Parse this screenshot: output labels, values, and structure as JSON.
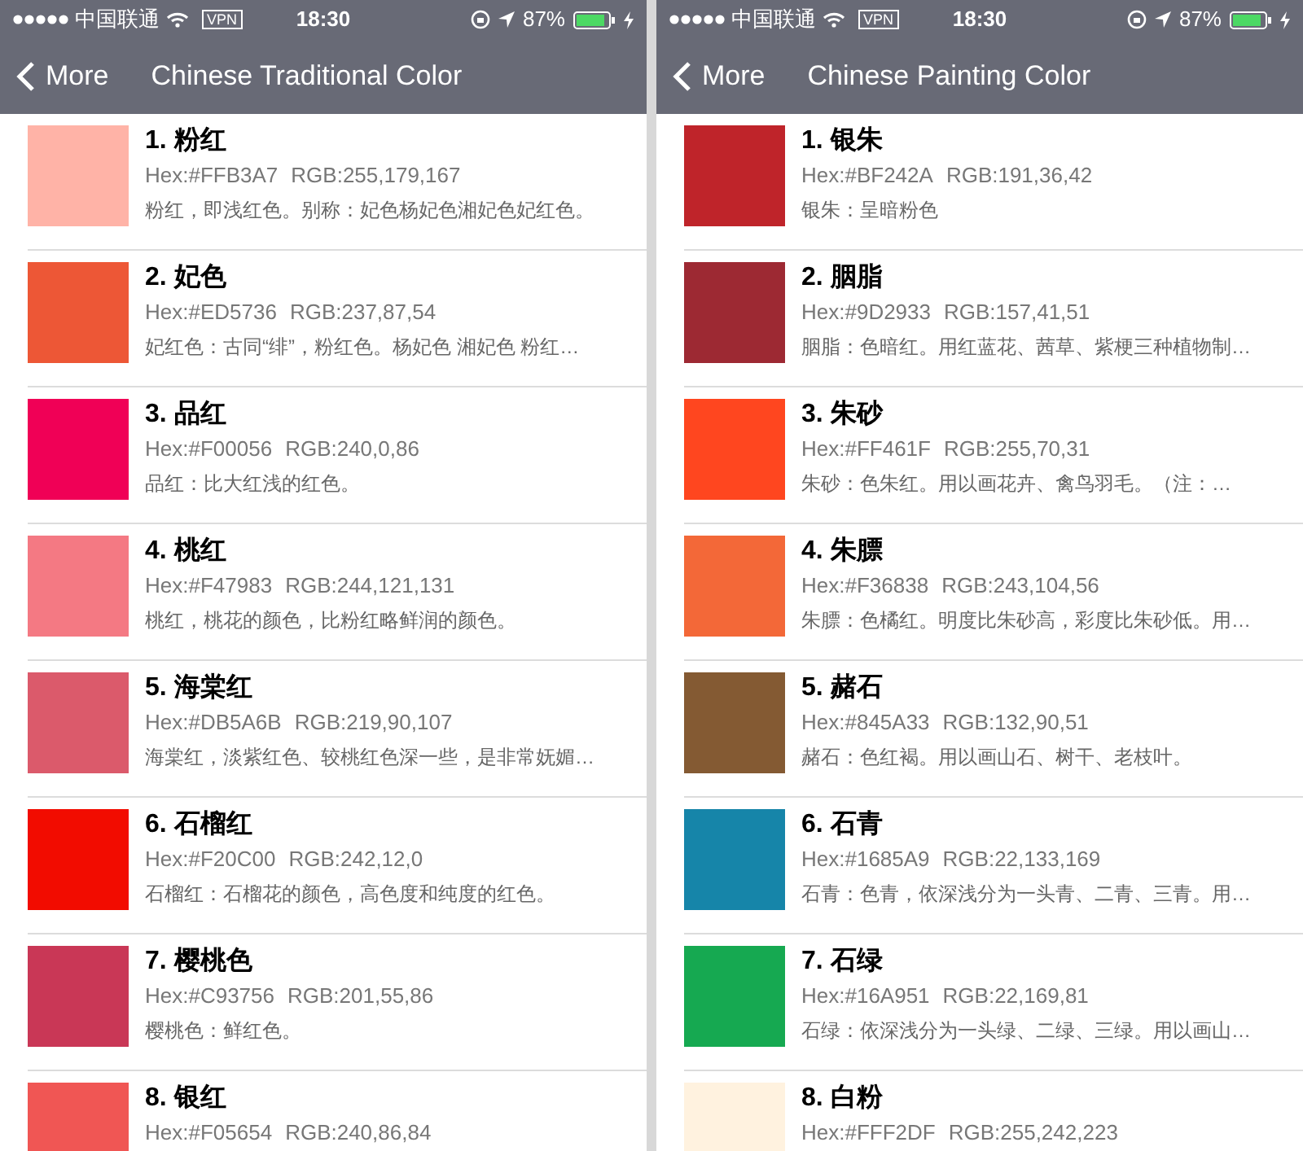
{
  "panels": [
    {
      "status_bar": {
        "carrier": "中国联通",
        "vpn": "VPN",
        "time": "18:30",
        "battery": "87%"
      },
      "nav": {
        "back": "More",
        "title": "Chinese Traditional Color"
      },
      "colors": [
        {
          "name": "1. 粉红",
          "hex": "Hex:#FFB3A7",
          "rgb": "RGB:255,179,167",
          "description": "粉红，即浅红色。别称：妃色杨妃色湘妃色妃红色。",
          "color": "#ffb3a7"
        },
        {
          "name": "2. 妃色",
          "hex": "Hex:#ED5736",
          "rgb": "RGB:237,87,54",
          "description": "妃红色：古同“绯”，粉红色。杨妃色 湘妃色 粉红…",
          "color": "#ed5736"
        },
        {
          "name": "3. 品红",
          "hex": "Hex:#F00056",
          "rgb": "RGB:240,0,86",
          "description": "品红：比大红浅的红色。",
          "color": "#f00056"
        },
        {
          "name": "4. 桃红",
          "hex": "Hex:#F47983",
          "rgb": "RGB:244,121,131",
          "description": "桃红，桃花的颜色，比粉红略鲜润的颜色。",
          "color": "#f47983"
        },
        {
          "name": "5. 海棠红",
          "hex": "Hex:#DB5A6B",
          "rgb": "RGB:219,90,107",
          "description": "海棠红，淡紫红色、较桃红色深一些，是非常妩媚…",
          "color": "#db5a6b"
        },
        {
          "name": "6. 石榴红",
          "hex": "Hex:#F20C00",
          "rgb": "RGB:242,12,0",
          "description": "石榴红：石榴花的颜色，高色度和纯度的红色。",
          "color": "#f20c00"
        },
        {
          "name": "7. 樱桃色",
          "hex": "Hex:#C93756",
          "rgb": "RGB:201,55,86",
          "description": "樱桃色：鲜红色。",
          "color": "#c93756"
        },
        {
          "name": "8. 银红",
          "hex": "Hex:#F05654",
          "rgb": "RGB:240,86,84",
          "color": "#f05654"
        }
      ]
    },
    {
      "status_bar": {
        "carrier": "中国联通",
        "vpn": "VPN",
        "time": "18:30",
        "battery": "87%"
      },
      "nav": {
        "back": "More",
        "title": "Chinese Painting Color"
      },
      "colors": [
        {
          "name": "1. 银朱",
          "hex": "Hex:#BF242A",
          "rgb": "RGB:191,36,42",
          "description": "银朱：呈暗粉色",
          "color": "#bf242a"
        },
        {
          "name": "2. 胭脂",
          "hex": "Hex:#9D2933",
          "rgb": "RGB:157,41,51",
          "description": "胭脂：色暗红。用红蓝花、茜草、紫梗三种植物制…",
          "color": "#9d2933"
        },
        {
          "name": "3. 朱砂",
          "hex": "Hex:#FF461F",
          "rgb": "RGB:255,70,31",
          "description": "朱砂：色朱红。用以画花卉、禽鸟羽毛。（注：…",
          "color": "#ff461f"
        },
        {
          "name": "4. 朱膘",
          "hex": "Hex:#F36838",
          "rgb": "RGB:243,104,56",
          "description": "朱膘：色橘红。明度比朱砂高，彩度比朱砂低。用…",
          "color": "#f36838"
        },
        {
          "name": "5. 赭石",
          "hex": "Hex:#845A33",
          "rgb": "RGB:132,90,51",
          "description": "赭石：色红褐。用以画山石、树干、老枝叶。",
          "color": "#845a33"
        },
        {
          "name": "6. 石青",
          "hex": "Hex:#1685A9",
          "rgb": "RGB:22,133,169",
          "description": "石青：色青，依深浅分为一头青、二青、三青。用…",
          "color": "#1685a9"
        },
        {
          "name": "7. 石绿",
          "hex": "Hex:#16A951",
          "rgb": "RGB:22,169,81",
          "description": "石绿：依深浅分为一头绿、二绿、三绿。用以画山…",
          "color": "#16a951"
        },
        {
          "name": "8. 白粉",
          "hex": "Hex:#FFF2DF",
          "rgb": "RGB:255,242,223",
          "color": "#fff2df"
        }
      ]
    }
  ]
}
